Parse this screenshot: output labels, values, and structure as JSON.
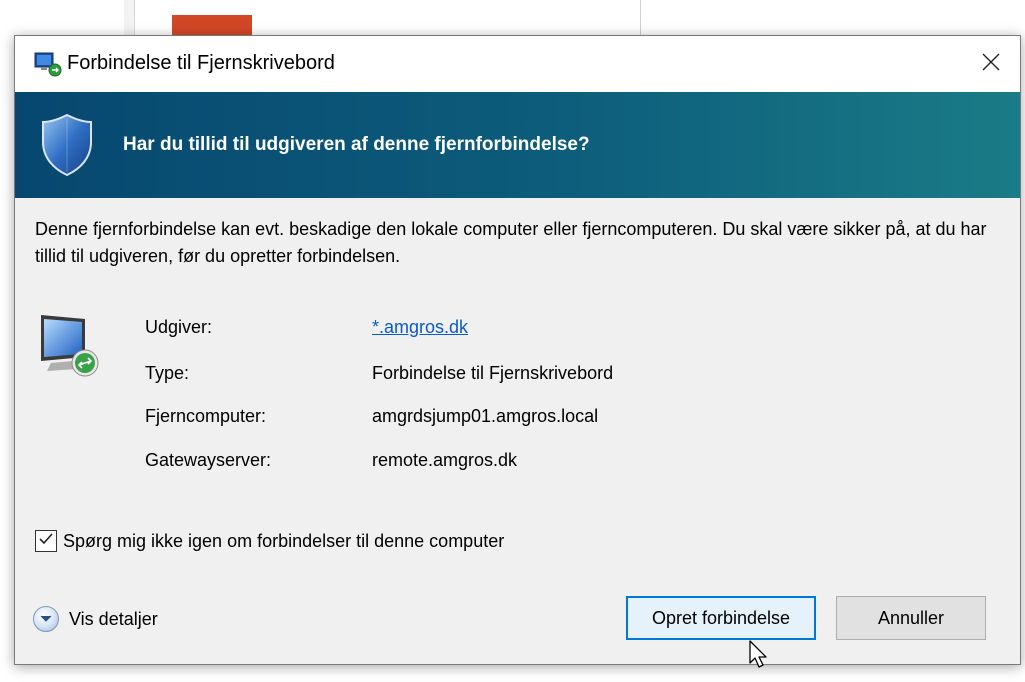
{
  "window": {
    "title": "Forbindelse til Fjernskrivebord",
    "app_icon": "remote-desktop-icon",
    "close_icon": "close-icon"
  },
  "header": {
    "icon": "shield-icon",
    "heading": "Har du tillid til udgiveren af denne fjernforbindelse?"
  },
  "message": "Denne fjernforbindelse kan evt. beskadige den lokale computer eller fjerncomputeren. Du skal være sikker på, at du har tillid til udgiveren, før du opretter forbindelsen.",
  "details_table": {
    "icon": "remote-computer-icon",
    "rows": [
      {
        "label": "Udgiver:",
        "value": "*.amgros.dk"
      },
      {
        "label": "Type:",
        "value": "Forbindelse til Fjernskrivebord"
      },
      {
        "label": "Fjerncomputer:",
        "value": "amgrdsjump01.amgros.local"
      },
      {
        "label": "Gatewayserver:",
        "value": "remote.amgros.dk"
      }
    ]
  },
  "checkbox": {
    "label": "Spørg mig ikke igen om forbindelser til denne computer",
    "checked": true
  },
  "footer": {
    "details_label": "Vis detaljer",
    "details_icon": "chevron-down-icon",
    "connect_label": "Opret forbindelse",
    "cancel_label": "Annuller"
  },
  "colors": {
    "header_start": "#07476f",
    "header_end": "#1a7c86",
    "link": "#0a5bc4",
    "primary_border": "#0078d7"
  }
}
